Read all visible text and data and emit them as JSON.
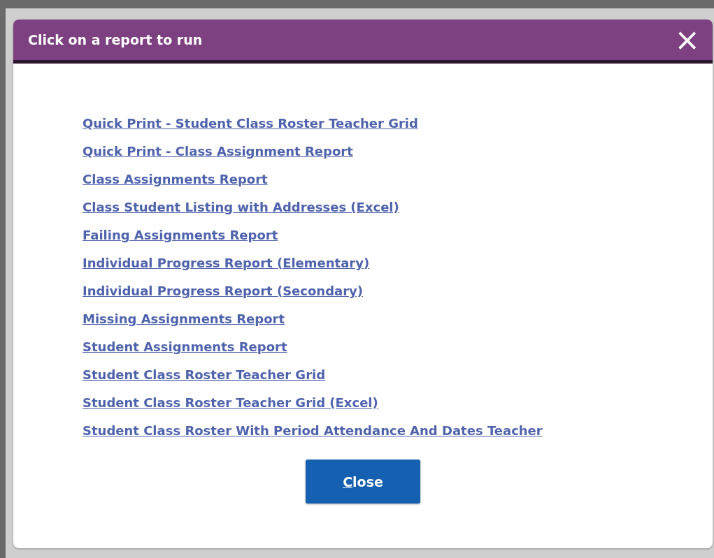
{
  "dialog": {
    "title": "Click on a report to run",
    "close_icon": "×"
  },
  "reports": [
    "Quick Print - Student Class Roster Teacher Grid",
    "Quick Print - Class Assignment Report",
    "Class Assignments Report",
    "Class Student Listing with Addresses (Excel)",
    "Failing Assignments Report",
    "Individual Progress Report (Elementary)",
    "Individual Progress Report (Secondary)",
    "Missing Assignments Report",
    "Student Assignments Report",
    "Student Class Roster Teacher Grid",
    "Student Class Roster Teacher Grid (Excel)",
    "Student Class Roster With Period Attendance And Dates Teacher"
  ],
  "buttons": [
    {
      "label": "Close",
      "kind": "primary"
    }
  ]
}
